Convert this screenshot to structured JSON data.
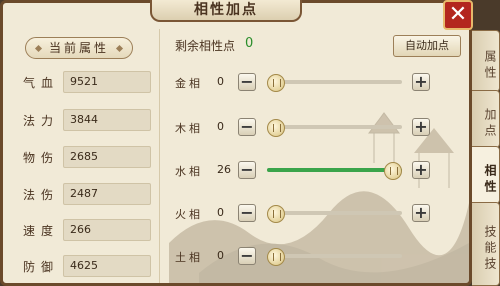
{
  "title": "相性加点",
  "close_label": "✕",
  "attributes": {
    "header": "当前属性",
    "stats": [
      {
        "label": "气血",
        "value": "9521"
      },
      {
        "label": "法力",
        "value": "3844"
      },
      {
        "label": "物伤",
        "value": "2685"
      },
      {
        "label": "法伤",
        "value": "2487"
      },
      {
        "label": "速度",
        "value": "266"
      },
      {
        "label": "防御",
        "value": "4625"
      }
    ]
  },
  "points": {
    "remaining_label": "剩余相性点",
    "remaining_value": "0",
    "auto_button": "自动加点",
    "minus": "−",
    "plus": "+",
    "sliders": [
      {
        "label": "金相",
        "value": "0",
        "fill": 0.0
      },
      {
        "label": "木相",
        "value": "0",
        "fill": 0.0
      },
      {
        "label": "水相",
        "value": "26",
        "fill": 1.0
      },
      {
        "label": "火相",
        "value": "0",
        "fill": 0.0
      },
      {
        "label": "土相",
        "value": "0",
        "fill": 0.0
      }
    ]
  },
  "side_tabs": [
    {
      "label": "属性"
    },
    {
      "label": "加点"
    },
    {
      "label": "相性"
    },
    {
      "label": "技能技"
    }
  ],
  "colors": {
    "accent_green": "#3aa44a",
    "close_red": "#b3261e"
  }
}
